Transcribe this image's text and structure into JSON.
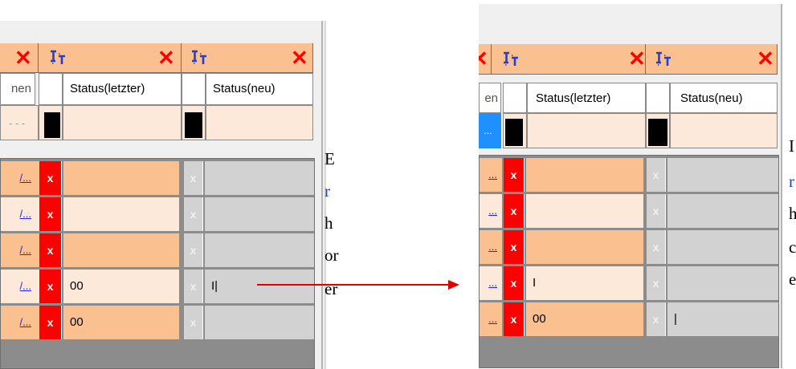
{
  "before": {
    "group_header": {
      "close_glyph": "✕"
    },
    "columns": {
      "partial_label": "nen",
      "status_old": "Status(letzter)",
      "status_new": "Status(neu)"
    },
    "filter": {
      "dropdown_text": "- - -"
    },
    "rows": [
      {
        "link": "/...",
        "x1": "x",
        "v1": "",
        "x2": "x",
        "v2": ""
      },
      {
        "link": "/...",
        "x1": "x",
        "v1": "",
        "x2": "x",
        "v2": ""
      },
      {
        "link": "/...",
        "x1": "x",
        "v1": "",
        "x2": "x",
        "v2": ""
      },
      {
        "link": "/...",
        "x1": "x",
        "v1": "00",
        "x2": "x",
        "v2": "I|"
      },
      {
        "link": "/...",
        "x1": "x",
        "v1": "00",
        "x2": "x",
        "v2": ""
      }
    ],
    "side_letters": [
      "E",
      "r",
      "h",
      "or",
      "er"
    ]
  },
  "after": {
    "group_header": {
      "close_glyph": "✕"
    },
    "columns": {
      "partial_label": "en",
      "status_old": "Status(letzter)",
      "status_new": "Status(neu)"
    },
    "filter": {
      "dropdown_text": "..."
    },
    "rows": [
      {
        "link": "...",
        "x1": "x",
        "v1": "",
        "x2": "x",
        "v2": ""
      },
      {
        "link": "...",
        "x1": "x",
        "v1": "",
        "x2": "x",
        "v2": ""
      },
      {
        "link": "...",
        "x1": "x",
        "v1": "",
        "x2": "x",
        "v2": ""
      },
      {
        "link": "...",
        "x1": "x",
        "v1": "I",
        "x2": "x",
        "v2": ""
      },
      {
        "link": "...",
        "x1": "x",
        "v1": "00",
        "x2": "x",
        "v2": "|"
      }
    ],
    "side_letters": [
      "I",
      "r",
      "h",
      "c",
      "e"
    ]
  },
  "colors": {
    "orange": "#fac090",
    "light_orange": "#fde9d9",
    "red": "#ff0000",
    "gray": "#d2d2d2",
    "arrow": "#e00000"
  }
}
